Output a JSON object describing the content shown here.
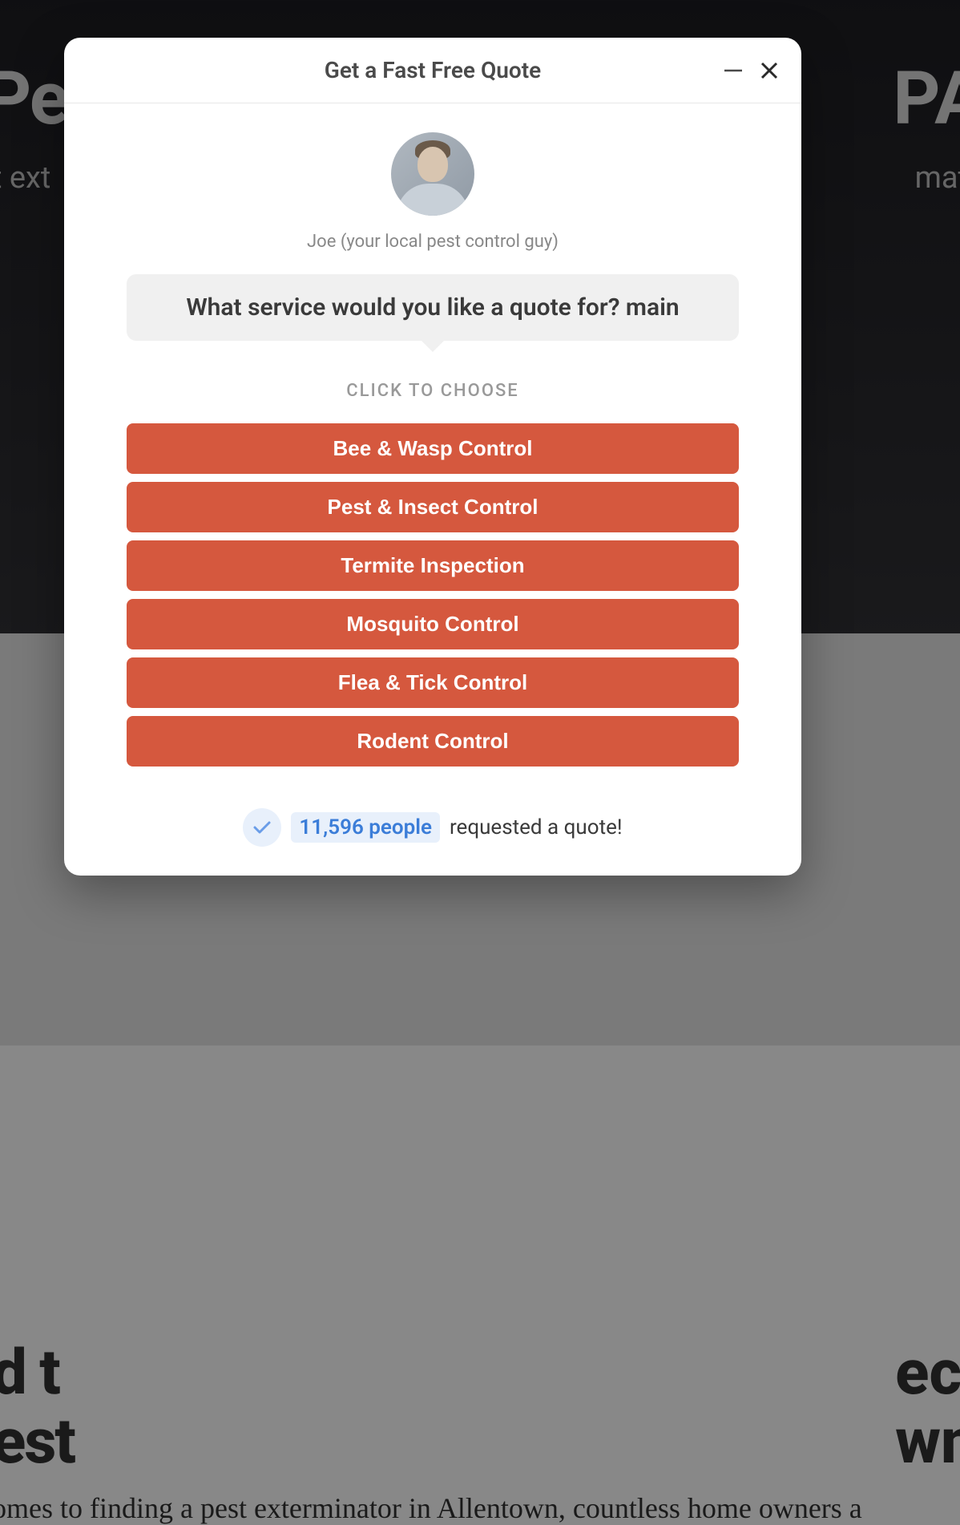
{
  "background": {
    "hero_title_left": "Pe",
    "hero_title_right": "PA",
    "hero_sub_left": "t ext",
    "hero_sub_right": "mat",
    "heading_left_1": "d t",
    "heading_left_2": "est",
    "heading_right_1": "ec",
    "heading_right_2": "wn",
    "para": "omes to finding a pest exterminator in Allentown, countless home owners a"
  },
  "modal": {
    "title": "Get a Fast Free Quote",
    "avatar_caption": "Joe (your local pest control guy)",
    "question": "What service would you like a quote for? main",
    "choose_label": "CLICK TO CHOOSE",
    "options": [
      "Bee & Wasp Control",
      "Pest & Insect Control",
      "Termite Inspection",
      "Mosquito Control",
      "Flea & Tick Control",
      "Rodent Control"
    ],
    "footer": {
      "count": "11,596 people",
      "suffix": " requested a quote!"
    }
  }
}
